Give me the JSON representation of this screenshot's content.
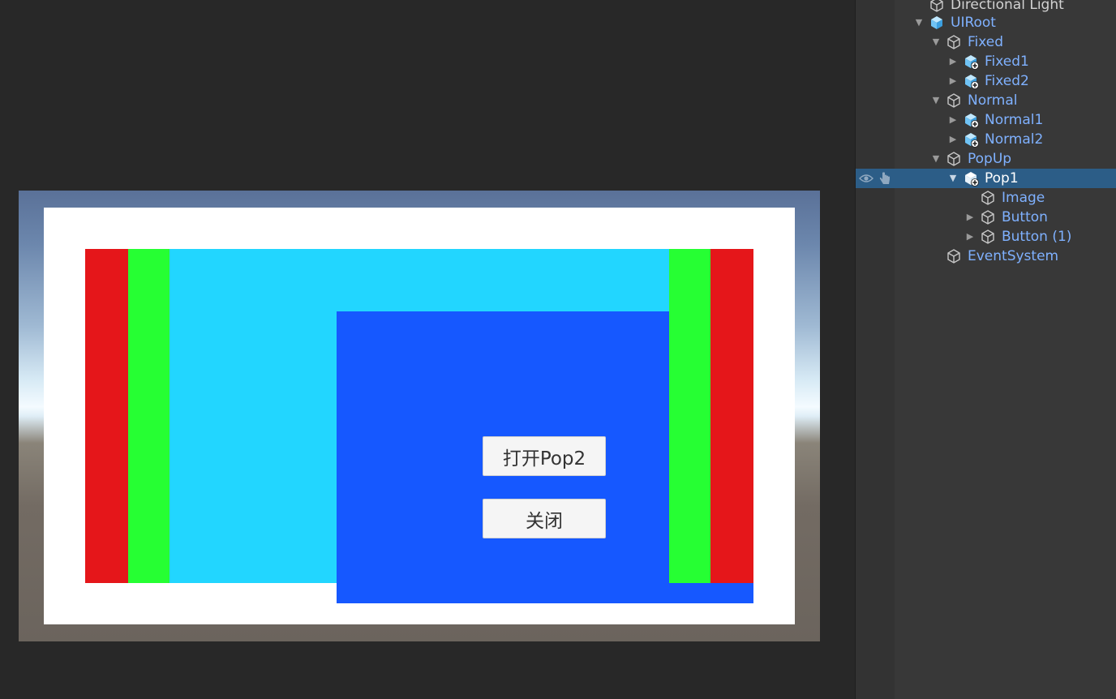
{
  "game_view": {
    "colors": {
      "white_panel": "#ffffff",
      "red": "#e5161a",
      "green": "#26ff33",
      "cyan": "#22d6ff",
      "blue": "#1658ff"
    },
    "buttons": {
      "open_pop2": "打开Pop2",
      "close": "关闭"
    }
  },
  "hierarchy": {
    "items": [
      {
        "label": "Directional Light",
        "icon": "gameobject-icon",
        "arrow": ""
      },
      {
        "label": "UIRoot",
        "icon": "prefab-icon",
        "arrow": "expanded"
      },
      {
        "label": "Fixed",
        "icon": "gameobject-icon",
        "arrow": "expanded"
      },
      {
        "label": "Fixed1",
        "icon": "prefab-variant-icon",
        "arrow": "collapsed"
      },
      {
        "label": "Fixed2",
        "icon": "prefab-variant-icon",
        "arrow": "collapsed"
      },
      {
        "label": "Normal",
        "icon": "gameobject-icon",
        "arrow": "expanded"
      },
      {
        "label": "Normal1",
        "icon": "prefab-variant-icon",
        "arrow": "collapsed"
      },
      {
        "label": "Normal2",
        "icon": "prefab-variant-icon",
        "arrow": "collapsed"
      },
      {
        "label": "PopUp",
        "icon": "gameobject-icon",
        "arrow": "expanded"
      },
      {
        "label": "Pop1",
        "icon": "prefab-variant-icon",
        "arrow": "expanded",
        "selected": true
      },
      {
        "label": "Image",
        "icon": "gameobject-icon",
        "arrow": ""
      },
      {
        "label": "Button",
        "icon": "gameobject-icon",
        "arrow": "collapsed"
      },
      {
        "label": "Button (1)",
        "icon": "gameobject-icon",
        "arrow": "collapsed"
      },
      {
        "label": "EventSystem",
        "icon": "gameobject-icon",
        "arrow": ""
      }
    ],
    "colors": {
      "selection": "#2c5d87",
      "prefab_text": "#7fb1ff"
    }
  }
}
